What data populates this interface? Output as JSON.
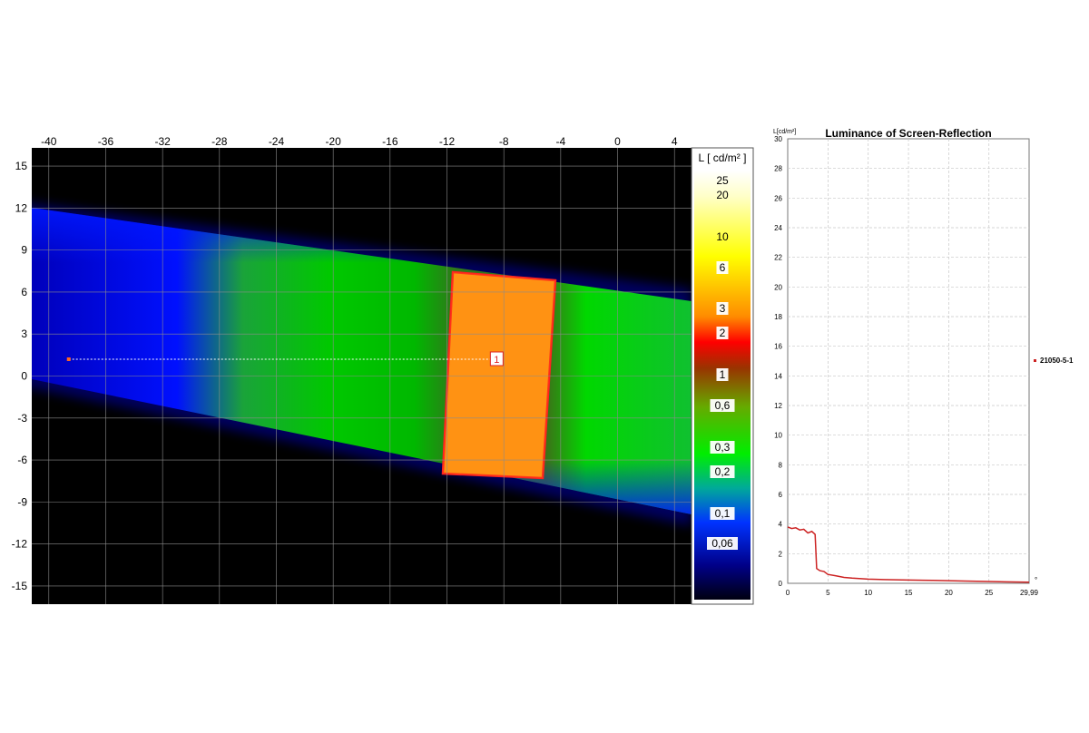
{
  "chart_data": [
    {
      "type": "heatmap",
      "x_ticks": [
        -40,
        -36,
        -32,
        -28,
        -24,
        -20,
        -16,
        -12,
        -8,
        -4,
        0,
        4
      ],
      "y_ticks": [
        15,
        12,
        9,
        6,
        3,
        0,
        -3,
        -6,
        -9,
        -12,
        -15
      ],
      "xlim": [
        -41.2,
        5.2
      ],
      "ylim": [
        -16.3,
        16.3
      ],
      "grid": true,
      "colorbar": {
        "title": "L [ cd/m² ]",
        "labels": [
          "25",
          "20",
          "10",
          "6",
          "3",
          "2",
          "1",
          "0,6",
          "0,3",
          "0,2",
          "0,1",
          "0,06"
        ]
      },
      "marker": {
        "label": "1",
        "start": {
          "x": -38.6,
          "y": 1.2
        },
        "end": {
          "x": -8.5,
          "y": 1.2
        }
      },
      "colors": {
        "background": "#000000",
        "grid": "#8c8c8c",
        "low": "#0000ff",
        "mid": "#00cc33",
        "high": "#ff8c00",
        "outline": "#ff1a1a"
      }
    },
    {
      "type": "line",
      "title": "Luminance of Screen-Reflection",
      "ylabel": "L[cd/m²]",
      "xlabel": "",
      "xlim": [
        0,
        29.99
      ],
      "ylim": [
        0,
        30
      ],
      "x_ticks": [
        "0",
        "5",
        "10",
        "15",
        "20",
        "25",
        "29,99"
      ],
      "y_ticks": [
        "0",
        "2",
        "4",
        "6",
        "8",
        "10",
        "12",
        "14",
        "16",
        "18",
        "20",
        "22",
        "24",
        "26",
        "28",
        "30"
      ],
      "x_end_unit": "°",
      "grid": true,
      "legend": "right",
      "series": [
        {
          "name": "21050-5-1",
          "color": "#cc2222",
          "x": [
            0,
            0.5,
            1.0,
            1.5,
            2.0,
            2.5,
            3.0,
            3.4,
            3.6,
            4.0,
            4.5,
            5.0,
            6.0,
            7.0,
            8.0,
            10.0,
            12.0,
            15.0,
            18.0,
            20.0,
            22.0,
            25.0,
            27.0,
            29.99
          ],
          "y": [
            3.8,
            3.7,
            3.75,
            3.6,
            3.65,
            3.4,
            3.5,
            3.3,
            1.0,
            0.85,
            0.8,
            0.6,
            0.5,
            0.4,
            0.35,
            0.28,
            0.25,
            0.22,
            0.2,
            0.18,
            0.15,
            0.12,
            0.1,
            0.08
          ]
        }
      ]
    }
  ]
}
